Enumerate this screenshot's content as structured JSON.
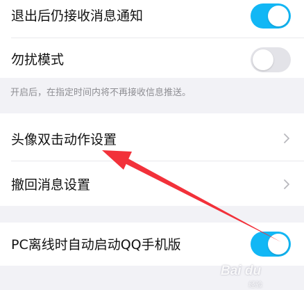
{
  "settings": {
    "background_notify": {
      "label": "退出后仍接收消息通知",
      "toggle": "on"
    },
    "dnd": {
      "label": "勿扰模式",
      "toggle": "off",
      "hint": "开启后，在指定时间内将不再接收信息推送。"
    },
    "avatar_double_tap": {
      "label": "头像双击动作设置"
    },
    "recall": {
      "label": "撤回消息设置"
    },
    "pc_offline": {
      "label": "PC离线时自动启动QQ手机版",
      "toggle": "on"
    }
  },
  "colors": {
    "accent": "#12b7f5",
    "arrow": "#f2313a",
    "background": "#f2f2f6"
  },
  "watermark": {
    "brand": "Bai du",
    "sub": "经验"
  }
}
